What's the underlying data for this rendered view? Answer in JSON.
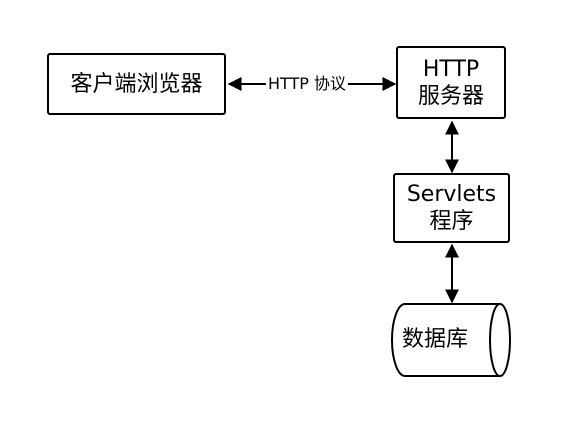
{
  "diagram": {
    "nodes": {
      "browser": {
        "label": "客户端浏览器"
      },
      "http_server": {
        "line1": "HTTP",
        "line2": "服务器"
      },
      "servlets": {
        "line1": "Servlets",
        "line2": "程序"
      },
      "database": {
        "label": "数据库"
      }
    },
    "edges": {
      "browser_http": {
        "label": "HTTP 协议",
        "direction": "bidirectional"
      },
      "http_servlets": {
        "direction": "bidirectional"
      },
      "servlets_db": {
        "direction": "bidirectional"
      }
    }
  }
}
